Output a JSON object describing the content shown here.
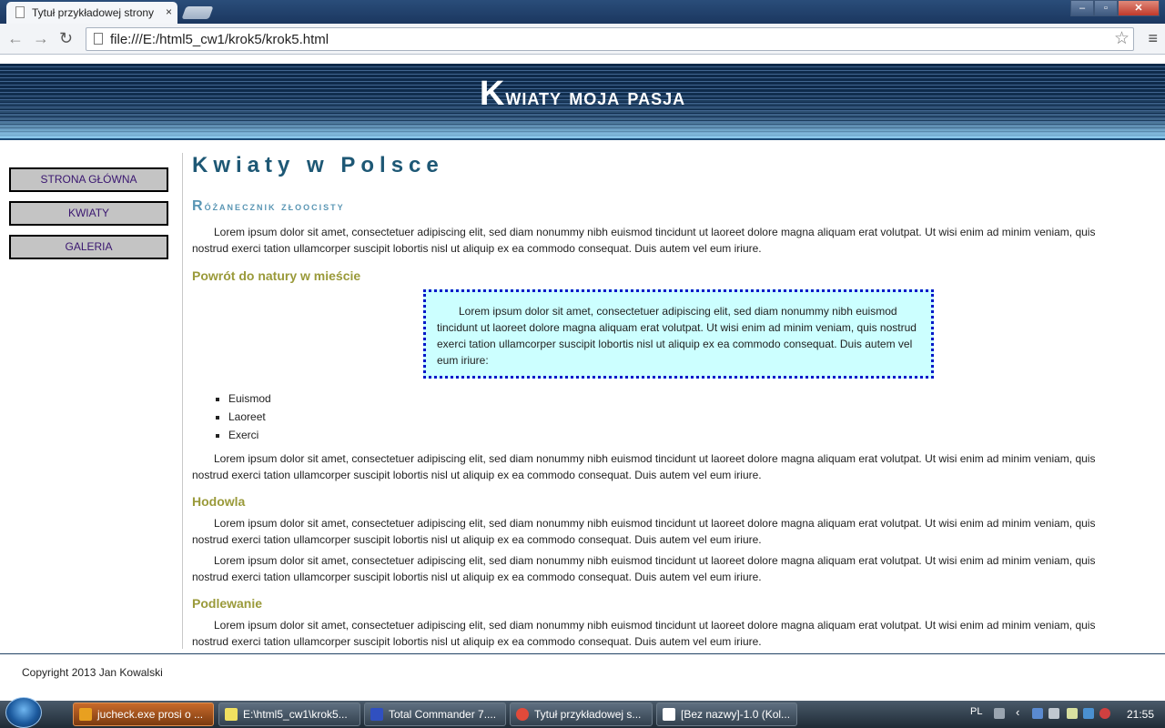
{
  "browser": {
    "tab_title": "Tytuł przykładowej strony",
    "tab_close": "×",
    "url": "file:///E:/html5_cw1/krok5/krok5.html",
    "back": "←",
    "forward": "→",
    "reload": "↻",
    "star": "☆",
    "menu": "≡",
    "win_min": "–",
    "win_max": "▫",
    "win_close": "✕"
  },
  "site": {
    "title_first": "K",
    "title_rest": "wiaty moja pasja"
  },
  "sidebar": {
    "items": [
      {
        "label": "STRONA GŁÓWNA"
      },
      {
        "label": "KWIATY"
      },
      {
        "label": "GALERIA"
      }
    ]
  },
  "main": {
    "heading": "Kwiaty w Polsce",
    "section1_first": "R",
    "section1_rest": "óżanecznik złoocisty",
    "para1": "Lorem ipsum dolor sit amet, consectetuer adipiscing elit, sed diam nonummy nibh euismod tincidunt ut laoreet dolore magna aliquam erat volutpat. Ut wisi enim ad minim veniam, quis nostrud exerci tation ullamcorper suscipit lobortis nisl ut aliquip ex ea commodo consequat. Duis autem vel eum iriure.",
    "section2": "Powrót do natury w mieście",
    "callout": "Lorem ipsum dolor sit amet, consectetuer adipiscing elit, sed diam nonummy nibh euismod tincidunt ut laoreet dolore magna aliquam erat volutpat. Ut wisi enim ad minim veniam, quis nostrud exerci tation ullamcorper suscipit lobortis nisl ut aliquip ex ea commodo consequat. Duis autem vel eum iriure:",
    "list": [
      "Euismod",
      "Laoreet",
      "Exerci"
    ],
    "para2": "Lorem ipsum dolor sit amet, consectetuer adipiscing elit, sed diam nonummy nibh euismod tincidunt ut laoreet dolore magna aliquam erat volutpat. Ut wisi enim ad minim veniam, quis nostrud exerci tation ullamcorper suscipit lobortis nisl ut aliquip ex ea commodo consequat. Duis autem vel eum iriure.",
    "section3": "Hodowla",
    "para3": "Lorem ipsum dolor sit amet, consectetuer adipiscing elit, sed diam nonummy nibh euismod tincidunt ut laoreet dolore magna aliquam erat volutpat. Ut wisi enim ad minim veniam, quis nostrud exerci tation ullamcorper suscipit lobortis nisl ut aliquip ex ea commodo consequat. Duis autem vel eum iriure.",
    "para4": "Lorem ipsum dolor sit amet, consectetuer adipiscing elit, sed diam nonummy nibh euismod tincidunt ut laoreet dolore magna aliquam erat volutpat. Ut wisi enim ad minim veniam, quis nostrud exerci tation ullamcorper suscipit lobortis nisl ut aliquip ex ea commodo consequat. Duis autem vel eum iriure.",
    "section4": "Podlewanie",
    "para5": "Lorem ipsum dolor sit amet, consectetuer adipiscing elit, sed diam nonummy nibh euismod tincidunt ut laoreet dolore magna aliquam erat volutpat. Ut wisi enim ad minim veniam, quis nostrud exerci tation ullamcorper suscipit lobortis nisl ut aliquip ex ea commodo consequat. Duis autem vel eum iriure."
  },
  "footer": {
    "copyright": "Copyright 2013 Jan Kowalski"
  },
  "taskbar": {
    "tasks": [
      {
        "label": "jucheck.exe prosi o ...",
        "icon_color": "#e8a020"
      },
      {
        "label": "E:\\html5_cw1\\krok5...",
        "icon_color": "#f0e060"
      },
      {
        "label": "Total Commander 7....",
        "icon_color": "#3050c0"
      },
      {
        "label": "Tytuł przykładowej s...",
        "icon_color": "#e04a3a"
      },
      {
        "label": "[Bez nazwy]-1.0 (Kol...",
        "icon_color": "#ffffff"
      }
    ],
    "lang": "PL",
    "chevron": "‹",
    "clock": "21:55"
  },
  "colors": {
    "heading": "#1e5875",
    "section_heading": "#9a9a3a",
    "callout_bg": "#ccffff",
    "callout_border": "#0018c8",
    "nav_bg": "#c4c4c4",
    "nav_text": "#3a1670"
  }
}
